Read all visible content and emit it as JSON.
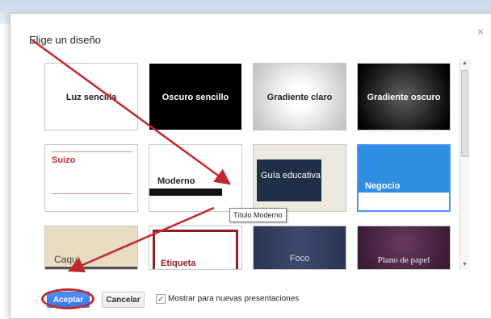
{
  "dialog": {
    "title": "Elige un diseño",
    "close_glyph": "×"
  },
  "themes": [
    {
      "label": "Luz sencilla"
    },
    {
      "label": "Oscuro sencillo"
    },
    {
      "label": "Gradiente claro"
    },
    {
      "label": "Gradiente oscuro"
    },
    {
      "label": "Suizo"
    },
    {
      "label": "Moderno"
    },
    {
      "label": "Guía educativa"
    },
    {
      "label": "Negocio"
    },
    {
      "label": "Caqui"
    },
    {
      "label": "Etiqueta"
    },
    {
      "label": "Foco"
    },
    {
      "label": "Plano de papel"
    }
  ],
  "tooltip": "Título Moderno",
  "footer": {
    "accept": "Aceptar",
    "cancel": "Cancelar",
    "checkbox_label": "Mostrar para nuevas presentaciones",
    "checkbox_checked": true
  },
  "colors": {
    "annotation_red": "#c0282d",
    "primary_blue": "#4d90fe",
    "selected_border": "#4d90fe"
  }
}
